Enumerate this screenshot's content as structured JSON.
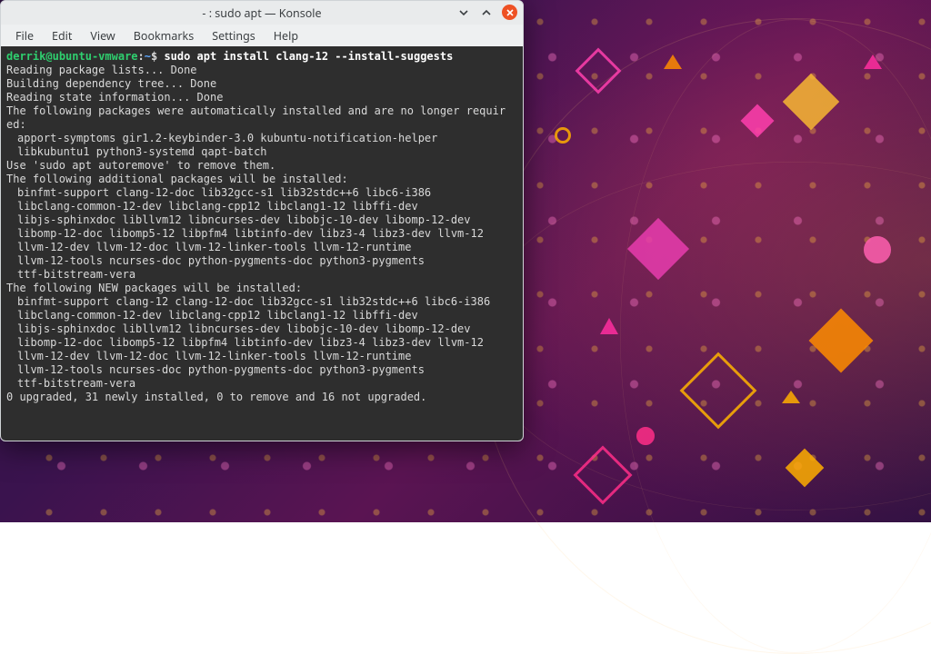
{
  "window": {
    "title": "- : sudo apt — Konsole"
  },
  "menu": {
    "file": "File",
    "edit": "Edit",
    "view": "View",
    "bookmarks": "Bookmarks",
    "settings": "Settings",
    "help": "Help"
  },
  "prompt": {
    "user": "derrik",
    "at": "@",
    "host": "ubuntu-vmware",
    "colon": ":",
    "path": "~",
    "sigil": "$ "
  },
  "command": "sudo apt install clang-12 --install-suggests",
  "out": {
    "l1": "Reading package lists... Done",
    "l2": "Building dependency tree... Done",
    "l3": "Reading state information... Done",
    "l4a": "The following packages were automatically installed and are no longer requir",
    "l4b": "ed:",
    "auto1": "apport-symptoms gir1.2-keybinder-3.0 kubuntu-notification-helper",
    "auto2": "libkubuntu1 python3-systemd qapt-batch",
    "l5": "Use 'sudo apt autoremove' to remove them.",
    "l6": "The following additional packages will be installed:",
    "add1": "binfmt-support clang-12-doc lib32gcc-s1 lib32stdc++6 libc6-i386",
    "add2": "libclang-common-12-dev libclang-cpp12 libclang1-12 libffi-dev",
    "add3": "libjs-sphinxdoc libllvm12 libncurses-dev libobjc-10-dev libomp-12-dev",
    "add4": "libomp-12-doc libomp5-12 libpfm4 libtinfo-dev libz3-4 libz3-dev llvm-12",
    "add5": "llvm-12-dev llvm-12-doc llvm-12-linker-tools llvm-12-runtime",
    "add6": "llvm-12-tools ncurses-doc python-pygments-doc python3-pygments",
    "add7": "ttf-bitstream-vera",
    "l7": "The following NEW packages will be installed:",
    "new1": "binfmt-support clang-12 clang-12-doc lib32gcc-s1 lib32stdc++6 libc6-i386",
    "new2": "libclang-common-12-dev libclang-cpp12 libclang1-12 libffi-dev",
    "new3": "libjs-sphinxdoc libllvm12 libncurses-dev libobjc-10-dev libomp-12-dev",
    "new4": "libomp-12-doc libomp5-12 libpfm4 libtinfo-dev libz3-4 libz3-dev llvm-12",
    "new5": "llvm-12-dev llvm-12-doc llvm-12-linker-tools llvm-12-runtime",
    "new6": "llvm-12-tools ncurses-doc python-pygments-doc python3-pygments",
    "new7": "ttf-bitstream-vera",
    "summary": "0 upgraded, 31 newly installed, 0 to remove and 16 not upgraded."
  }
}
